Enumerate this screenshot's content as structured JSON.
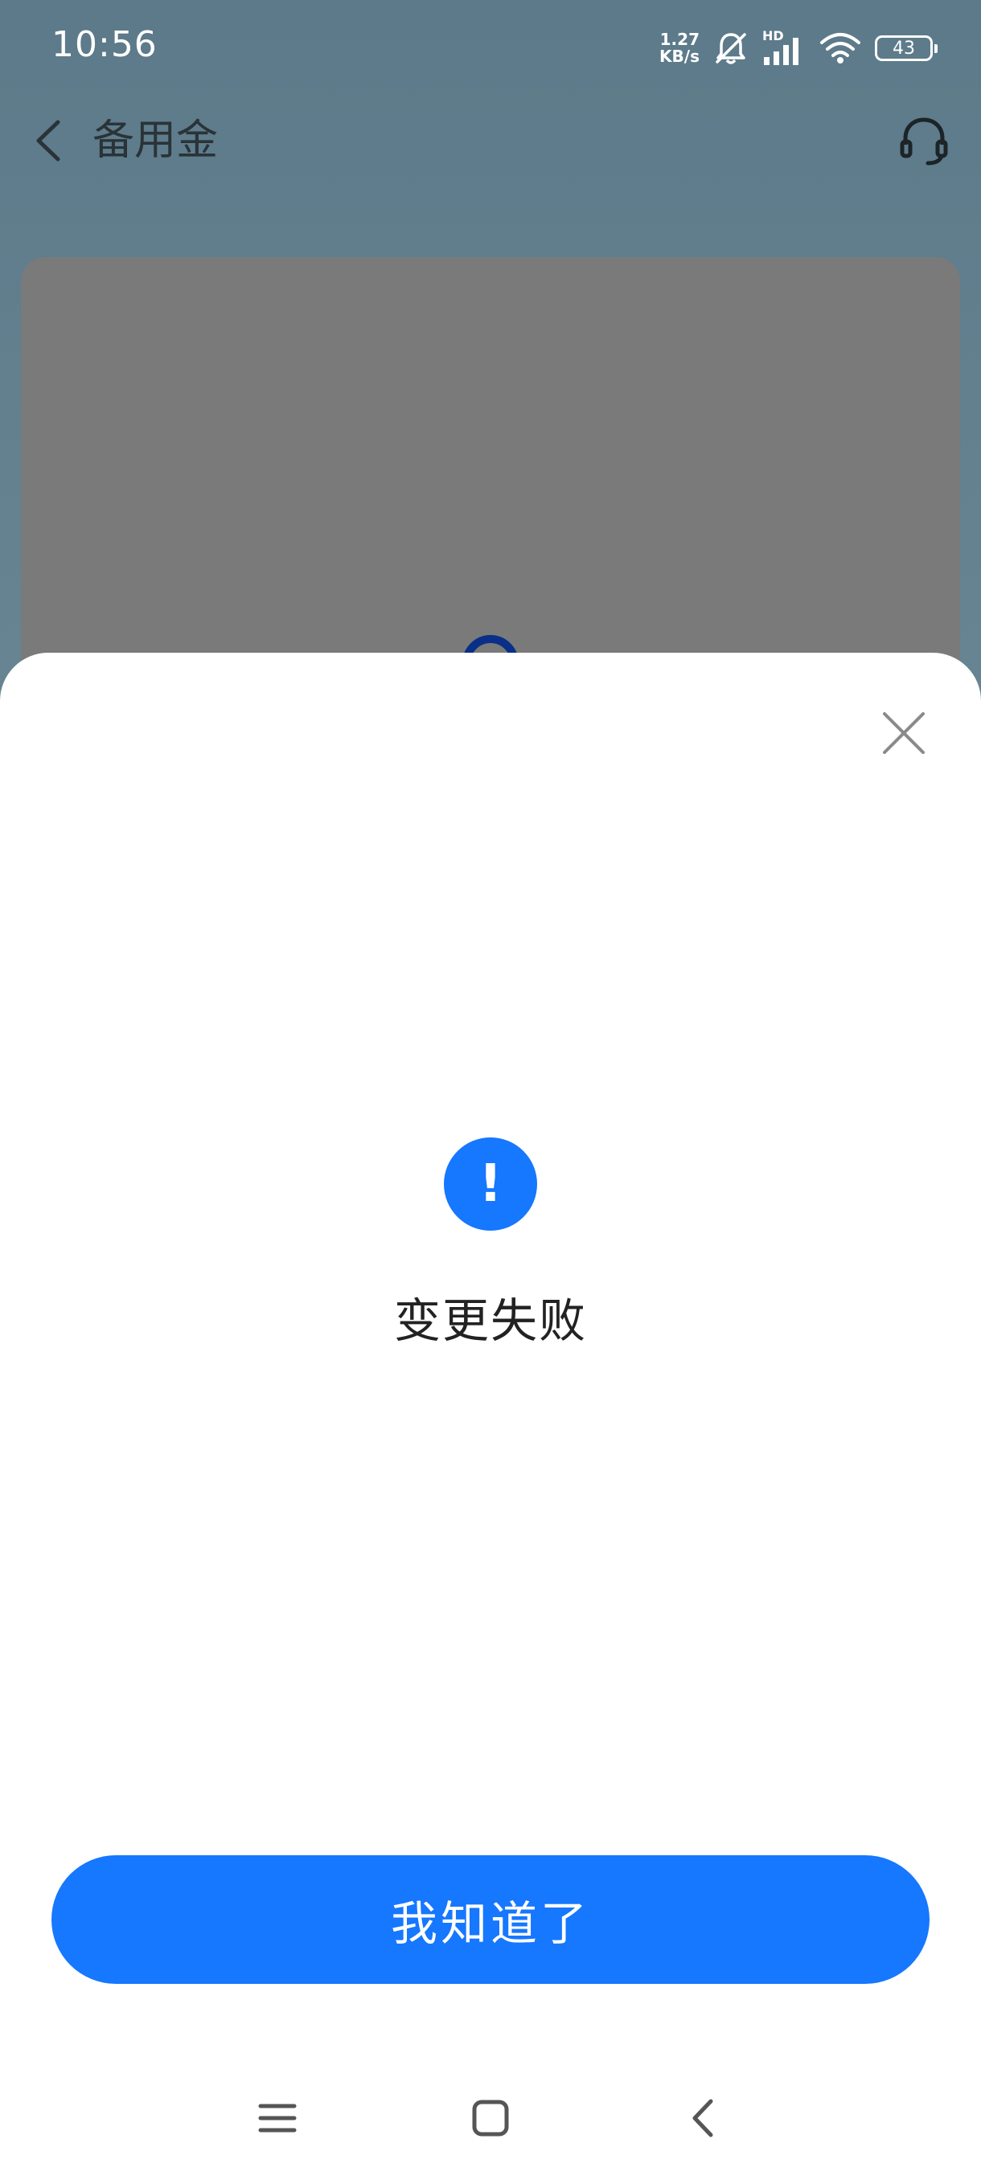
{
  "status_bar": {
    "time": "10:56",
    "net_speed_value": "1.27",
    "net_speed_unit": "KB/s",
    "signal_label": "HD",
    "battery_level": "43"
  },
  "header": {
    "title": "备用金"
  },
  "dialog": {
    "result_title": "变更失败",
    "alert_symbol": "!",
    "confirm_label": "我知道了"
  },
  "colors": {
    "accent": "#1677ff"
  }
}
